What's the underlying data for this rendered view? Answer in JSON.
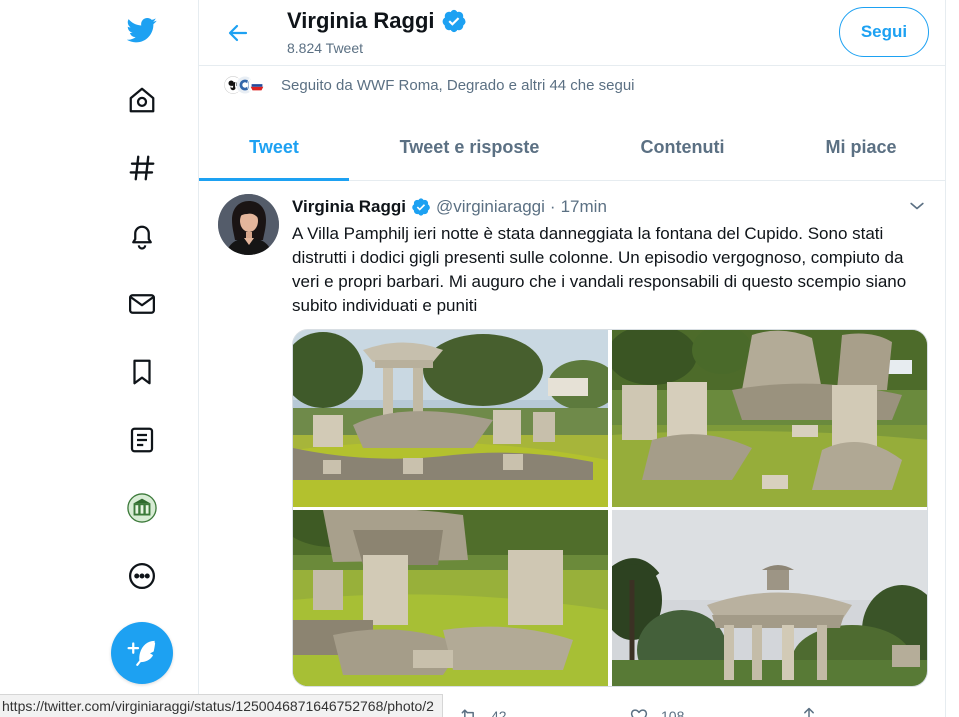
{
  "nav": {
    "items": [
      {
        "name": "twitter-logo-icon"
      },
      {
        "name": "home-icon"
      },
      {
        "name": "explore-hashtag-icon"
      },
      {
        "name": "notifications-bell-icon"
      },
      {
        "name": "messages-envelope-icon"
      },
      {
        "name": "bookmarks-icon"
      },
      {
        "name": "lists-icon"
      },
      {
        "name": "profile-avatar-icon"
      },
      {
        "name": "more-options-icon"
      }
    ],
    "compose_icon": "compose-tweet-icon"
  },
  "header": {
    "name": "Virginia Raggi",
    "tweet_count": "8.824 Tweet",
    "follow_label": "Segui"
  },
  "followed_by": "Seguito da WWF Roma, Degrado e altri 44 che segui",
  "tabs": [
    {
      "label": "Tweet",
      "active": true
    },
    {
      "label": "Tweet e risposte",
      "active": false
    },
    {
      "label": "Contenuti",
      "active": false
    },
    {
      "label": "Mi piace",
      "active": false
    }
  ],
  "tweet": {
    "name": "Virginia Raggi",
    "handle": "@virginiaraggi",
    "dot": "·",
    "time": "17min",
    "text": "A Villa Pamphilj ieri notte è stata danneggiata la fontana del Cupido. Sono stati distrutti i dodici gigli presenti sulle colonne. Un episodio vergognoso, compiuto da veri e propri barbari. Mi auguro che i vandali responsabili di questo scempio siano subito individuati e puniti",
    "retweets": "42",
    "likes": "108"
  },
  "status_url": "https://twitter.com/virginiaraggi/status/1250046871646752768/photo/2",
  "colors": {
    "accent": "#1da1f2",
    "secondary_text": "#5b7083"
  }
}
